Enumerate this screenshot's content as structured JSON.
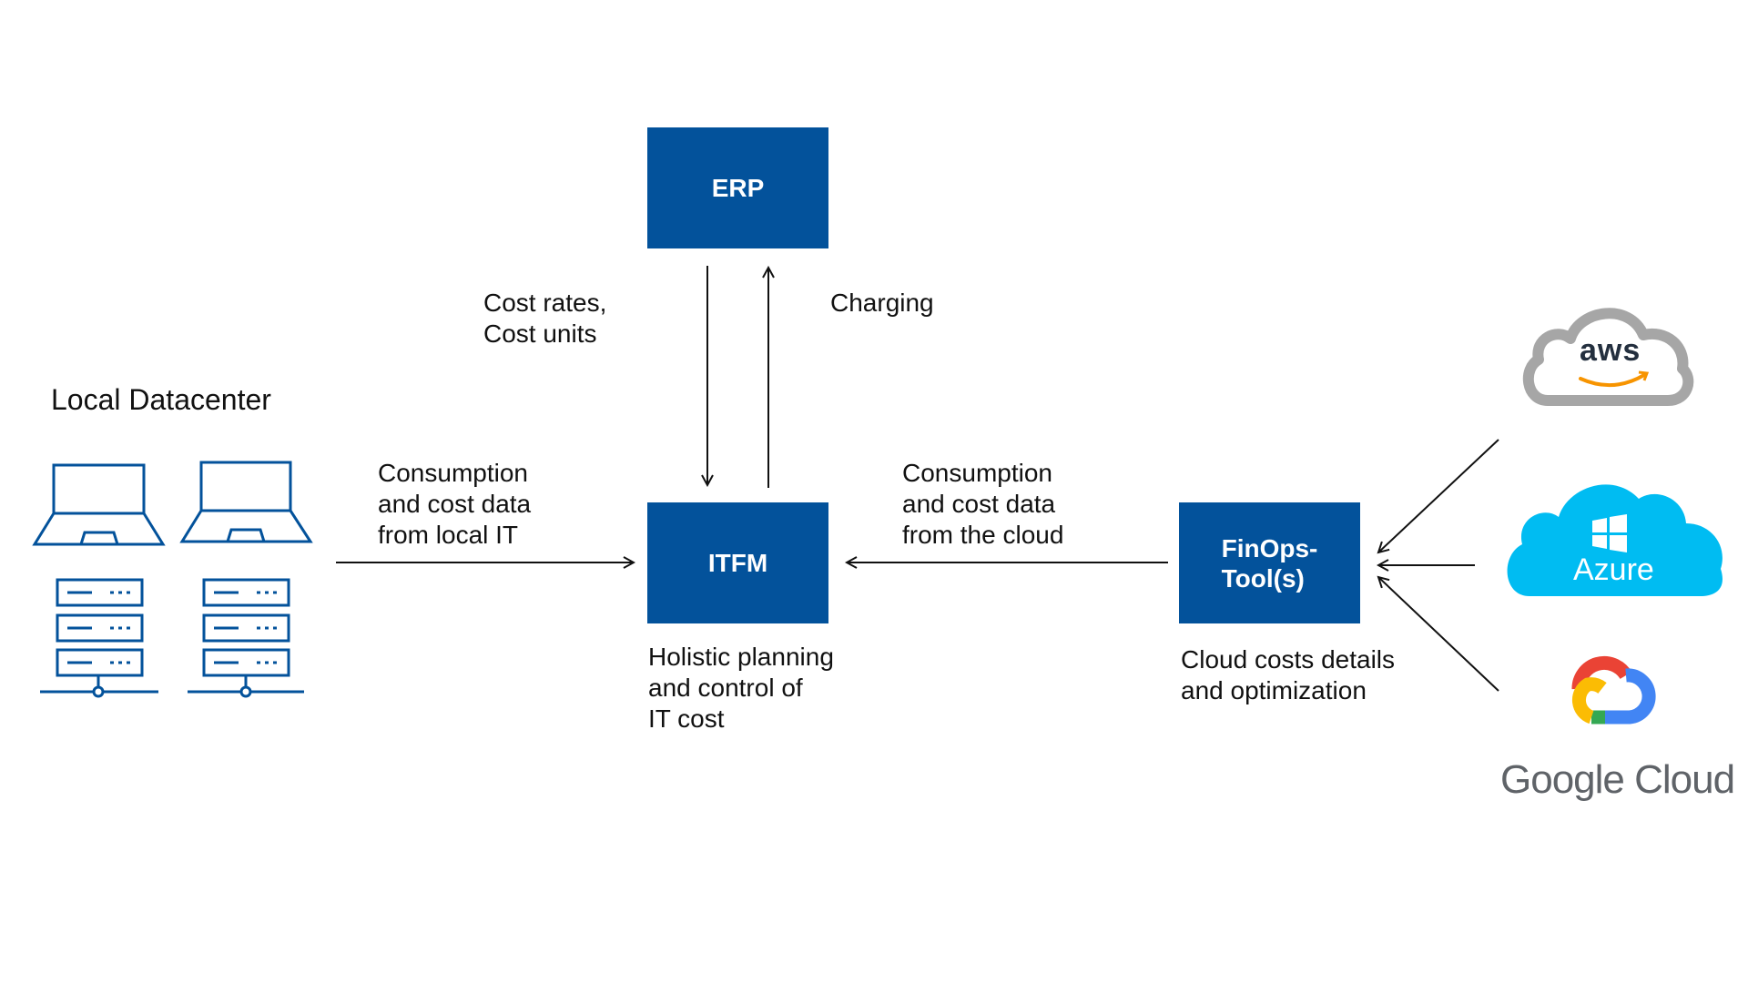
{
  "diagram": {
    "boxes": {
      "erp": {
        "label": "ERP"
      },
      "itfm": {
        "label": "ITFM"
      },
      "finops": {
        "line1": "FinOps-",
        "line2": "Tool(s)"
      }
    },
    "labels": {
      "local_datacenter": "Local Datacenter",
      "cost_rates": [
        "Cost rates,",
        "Cost units"
      ],
      "charging": "Charging",
      "local_flow": [
        "Consumption",
        "and cost data",
        "from local IT"
      ],
      "cloud_flow": [
        "Consumption",
        "and cost data",
        "from the cloud"
      ],
      "itfm_caption": [
        "Holistic planning",
        "and control of",
        "IT cost"
      ],
      "finops_caption": [
        "Cloud costs details",
        "and optimization"
      ]
    },
    "providers": {
      "aws": {
        "label": "aws",
        "icon": "aws-cloud-logo"
      },
      "azure": {
        "label": "Azure",
        "icon": "azure-cloud-logo"
      },
      "google": {
        "label": "Google Cloud",
        "icon": "google-cloud-logo"
      }
    },
    "icons": {
      "laptops": [
        "laptop-icon",
        "laptop-icon"
      ],
      "servers": [
        "server-rack-icon",
        "server-rack-icon"
      ]
    },
    "edges": [
      {
        "from": "ERP",
        "to": "ITFM",
        "label": "Cost rates, Cost units"
      },
      {
        "from": "ITFM",
        "to": "ERP",
        "label": "Charging"
      },
      {
        "from": "Local Datacenter",
        "to": "ITFM",
        "label": "Consumption and cost data from local IT"
      },
      {
        "from": "FinOps-Tool(s)",
        "to": "ITFM",
        "label": "Consumption and cost data from the cloud"
      },
      {
        "from": "aws",
        "to": "FinOps-Tool(s)",
        "label": ""
      },
      {
        "from": "Azure",
        "to": "FinOps-Tool(s)",
        "label": ""
      },
      {
        "from": "Google Cloud",
        "to": "FinOps-Tool(s)",
        "label": ""
      }
    ],
    "colors": {
      "box": "#03529b",
      "icon_stroke": "#03529b",
      "azure": "#00bcf2",
      "aws_cloud": "#a6a6a6",
      "aws_smile": "#f79400"
    }
  }
}
